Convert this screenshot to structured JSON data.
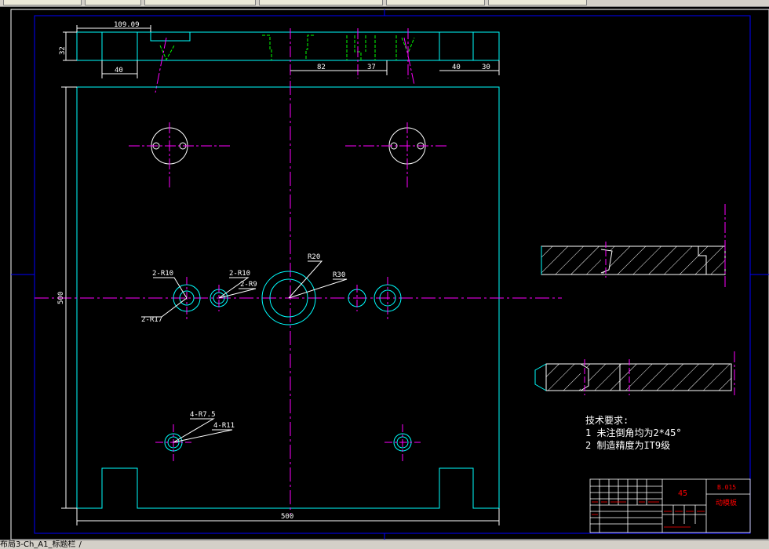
{
  "tabs": {
    "layout": "布局3-Ch_A1_标题栏",
    "separator": "/"
  },
  "drawing": {
    "dimensions": {
      "top_width": "109.09",
      "height_32": "32",
      "d40_left": "40",
      "d82": "82",
      "d37": "37",
      "d40_right": "40",
      "d30": "30",
      "vertical_500": "500",
      "horizontal_500": "500"
    },
    "radius_labels": {
      "r10a": "2-R10",
      "r17": "2-R17",
      "r10b": "2-R10",
      "r9": "2-R9",
      "r20": "R20",
      "r30": "R30",
      "r75": "4-R7.5",
      "r11": "4-R11"
    },
    "notes": {
      "heading": "技术要求:",
      "line1": "1  未注倒角均为2*45°",
      "line2": "2  制造精度为IT9级"
    },
    "title_block": {
      "material": "45",
      "drawing_no": "B.015",
      "part_name": "动模板"
    }
  },
  "colors": {
    "background": "#000000",
    "outline": "#00ffff",
    "center_line": "#ff00ff",
    "hidden_line": "#00ff00",
    "dimension": "#ffffff",
    "frame": "#0000ff",
    "title_red": "#ff0000"
  }
}
